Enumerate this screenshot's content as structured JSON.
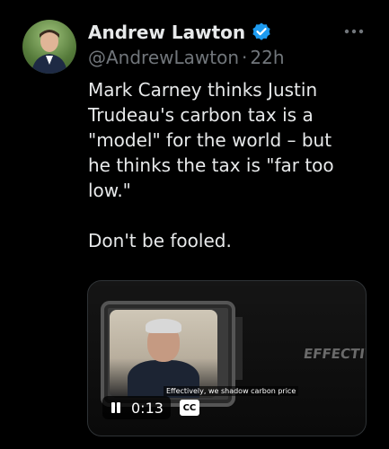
{
  "author": {
    "display_name": "Andrew Lawton",
    "handle": "@AndrewLawton",
    "separator": "·",
    "time_ago": "22h",
    "verified": true
  },
  "icons": {
    "verified": "verified-badge-icon",
    "more": "more-options-icon",
    "pause": "pause-icon",
    "captions": "closed-captions-icon"
  },
  "colors": {
    "background": "#000000",
    "text": "#e7e9ea",
    "secondary": "#71767b",
    "verified": "#1d9bf0"
  },
  "tweet": {
    "text": "Mark Carney thinks Justin\nTrudeau's carbon tax is a\n\"model\" for the world – but\nhe thinks the tax is \"far too\nlow.\"\n\nDon't be fooled."
  },
  "video": {
    "overlay_text": "EFFECTIVELY A SHADOW",
    "caption": "Effectively, we shadow carbon price",
    "elapsed": "0:13",
    "cc_label": "CC"
  }
}
